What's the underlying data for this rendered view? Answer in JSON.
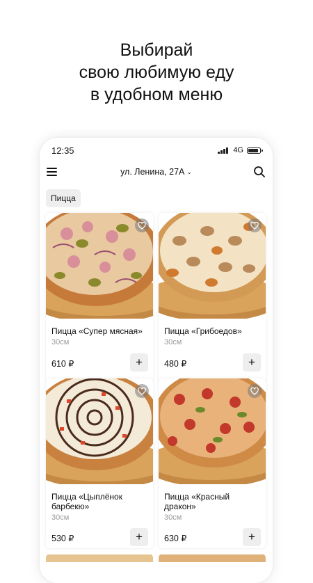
{
  "promo": {
    "line1": "Выбирай",
    "line2": "свою любимую еду",
    "line3": "в удобном меню"
  },
  "status_bar": {
    "time": "12:35",
    "network": "4G"
  },
  "header": {
    "address": "ул. Ленина, 27А",
    "address_chevron": "⌄"
  },
  "category": {
    "selected": "Пицца"
  },
  "products": [
    {
      "name": "Пицца «Супер мясная»",
      "size": "30см",
      "price": "610 ₽",
      "add": "+"
    },
    {
      "name": "Пицца «Грибоедов»",
      "size": "30см",
      "price": "480 ₽",
      "add": "+"
    },
    {
      "name": "Пицца «Цыплёнок барбекю»",
      "size": "30см",
      "price": "530 ₽",
      "add": "+"
    },
    {
      "name": "Пицца «Красный дракон»",
      "size": "30см",
      "price": "630 ₽",
      "add": "+"
    }
  ],
  "icons": {
    "menu": "hamburger-icon",
    "search": "search-icon",
    "favorite": "heart-icon",
    "add": "plus-icon"
  },
  "colors": {
    "background": "#ffffff",
    "chip_bg": "#eeeeee",
    "text": "#111111",
    "muted": "#9a9a9a"
  }
}
